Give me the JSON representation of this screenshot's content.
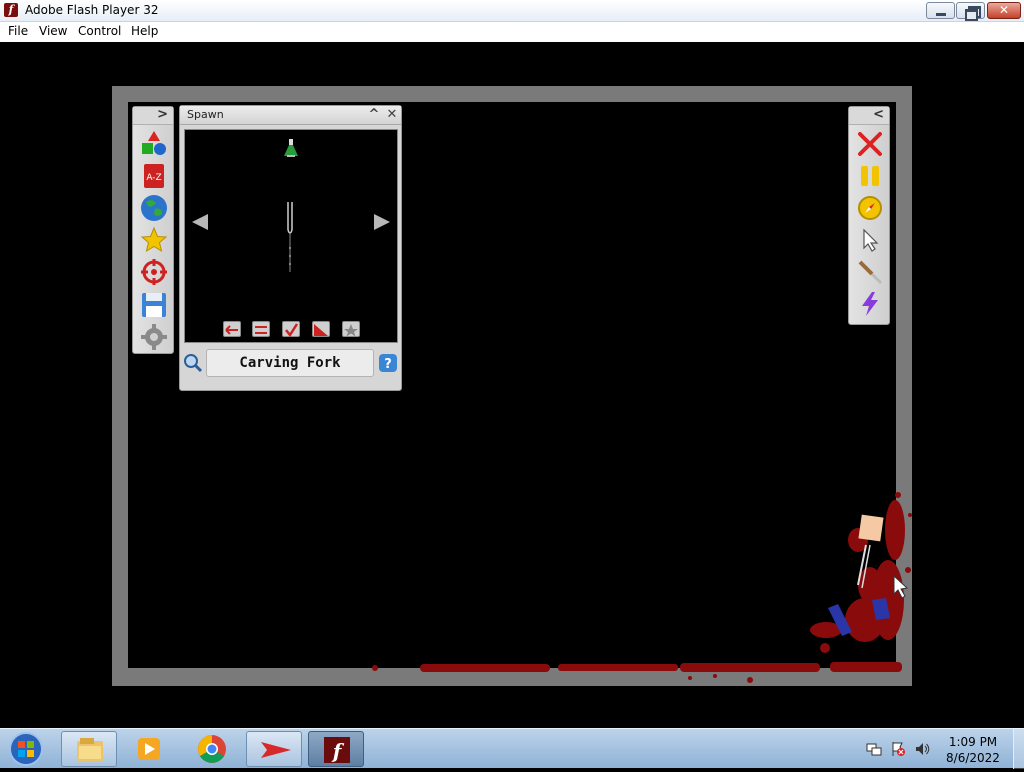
{
  "window": {
    "title": "Adobe Flash Player 32",
    "app_icon_glyph": "f",
    "buttons": {
      "minimize": "minimize-icon",
      "maximize": "restore-icon",
      "close": "close-icon",
      "close_glyph": "✕"
    }
  },
  "menu": {
    "items": [
      {
        "label": "File"
      },
      {
        "label": "View"
      },
      {
        "label": "Control"
      },
      {
        "label": "Help"
      }
    ]
  },
  "left_toolbar": {
    "collapse_glyph": ">",
    "tools": [
      "shapes-icon",
      "a-z-icon",
      "globe-icon",
      "star-icon",
      "target-icon",
      "save-icon",
      "gear-icon"
    ]
  },
  "spawn_panel": {
    "title": "Spawn",
    "minimize_glyph": "^",
    "close_glyph": "✕",
    "selected_item": "Carving Fork",
    "preview_item_icon": "carving-fork-icon",
    "category_icon": "flask-icon",
    "option_icons": [
      "flip-icon",
      "swap-icon",
      "check-icon",
      "diagonal-icon",
      "star-badge-icon"
    ]
  },
  "right_toolbar": {
    "collapse_glyph": "<",
    "tools": [
      "close-x-icon",
      "pause-icon",
      "compass-icon",
      "cursor-icon",
      "knife-icon",
      "lightning-icon"
    ]
  },
  "taskbar": {
    "apps": [
      "windows-explorer-icon",
      "media-player-icon",
      "chrome-icon",
      "arrow-app-icon",
      "flash-player-icon"
    ],
    "tray": [
      "network-icon",
      "flag-icon",
      "volume-icon"
    ],
    "time": "1:09 PM",
    "date": "8/6/2022"
  },
  "colors": {
    "blood": "#8a0b0b",
    "frame": "#7a7a7a",
    "panel": "#d6d6d6"
  }
}
